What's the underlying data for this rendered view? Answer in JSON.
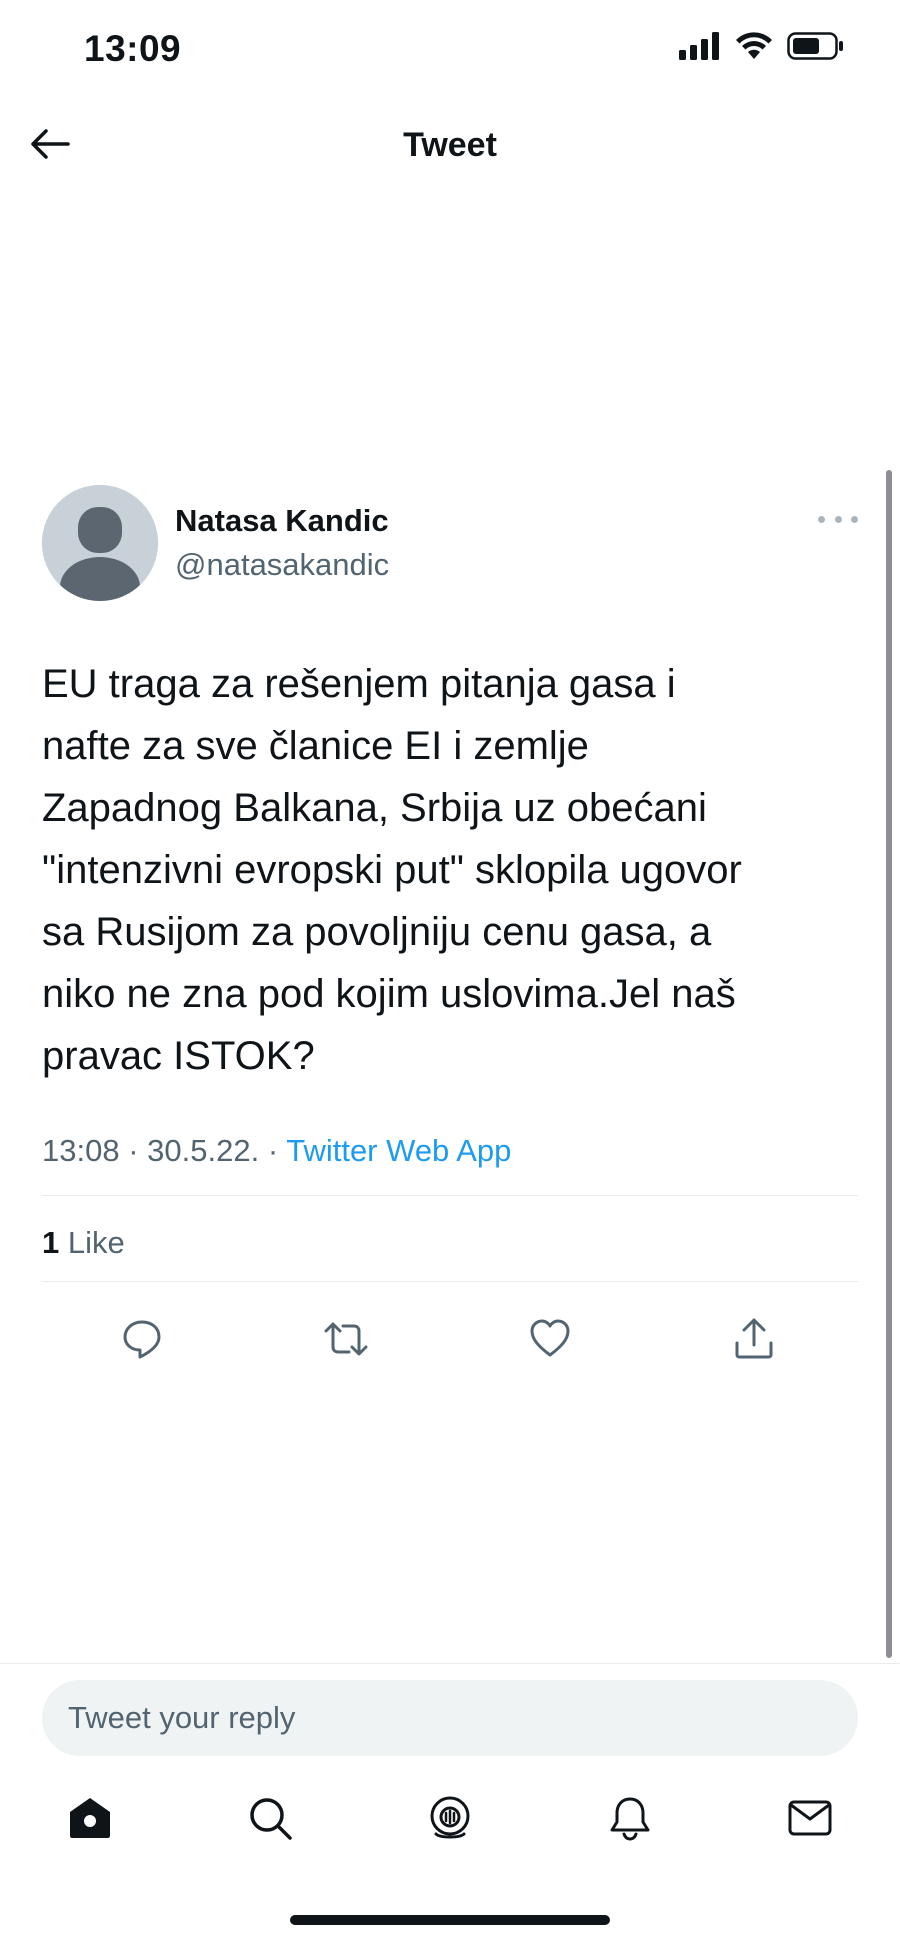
{
  "status_bar": {
    "time": "13:09",
    "icons": [
      "cellular-signal-icon",
      "wifi-icon",
      "battery-icon"
    ]
  },
  "header": {
    "back_icon": "arrow-left-icon",
    "title": "Tweet"
  },
  "tweet": {
    "author": {
      "name": "Natasa Kandic",
      "handle": "@natasakandic",
      "avatar_icon": "default-avatar-icon"
    },
    "more_icon": "more-horizontal-icon",
    "text": "EU traga za rešenjem pitanja gasa i\nnafte za sve članice EI i zemlje\nZapadnog Balkana, Srbija uz obećani\n\"intenzivni evropski put\" sklopila ugovor\nsa Rusijom za povoljniju cenu gasa, a\nniko ne zna pod kojim uslovima.Jel naš\npravac ISTOK?",
    "time": "13:08",
    "date": "30.5.22.",
    "separator": "·",
    "source": "Twitter Web App",
    "likes_count": "1",
    "likes_label": "Like",
    "actions": [
      "reply-icon",
      "retweet-icon",
      "like-icon",
      "share-icon"
    ]
  },
  "reply": {
    "placeholder": "Tweet your reply"
  },
  "tab_bar": {
    "tabs": [
      "home-icon",
      "search-icon",
      "spaces-icon",
      "notifications-icon",
      "messages-icon"
    ]
  },
  "colors": {
    "text": "#0f1419",
    "secondary": "#536471",
    "accent": "#1d9bf0",
    "divider": "#e6ecf0",
    "input_bg": "#eff3f4"
  }
}
